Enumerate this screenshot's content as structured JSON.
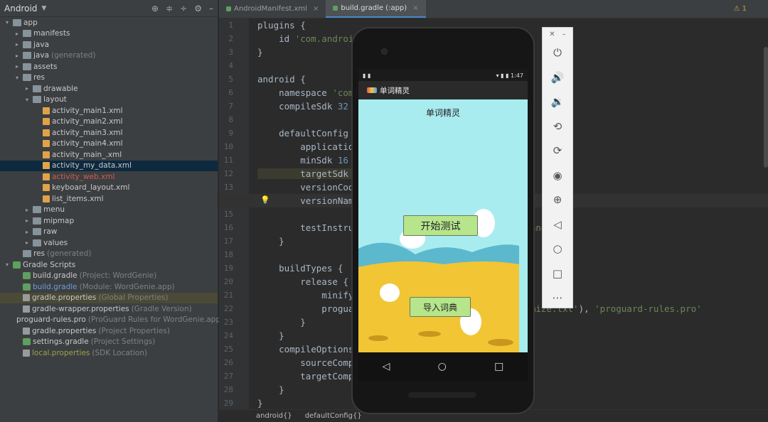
{
  "project_panel": {
    "title": "Android",
    "tree": [
      {
        "label": "app",
        "depth": 0,
        "arrow": "▾",
        "icon": "folder-icon",
        "style": ""
      },
      {
        "label": "manifests",
        "depth": 1,
        "arrow": "▸",
        "icon": "folder-icon",
        "style": ""
      },
      {
        "label": "java",
        "depth": 1,
        "arrow": "▸",
        "icon": "folder-icon",
        "style": ""
      },
      {
        "label": "java",
        "hint": "(generated)",
        "depth": 1,
        "arrow": "▸",
        "icon": "folder-icon",
        "style": ""
      },
      {
        "label": "assets",
        "depth": 1,
        "arrow": "▸",
        "icon": "folder-icon",
        "style": ""
      },
      {
        "label": "res",
        "depth": 1,
        "arrow": "▾",
        "icon": "folder-icon",
        "style": ""
      },
      {
        "label": "drawable",
        "depth": 2,
        "arrow": "▸",
        "icon": "folder-icon",
        "style": ""
      },
      {
        "label": "layout",
        "depth": 2,
        "arrow": "▾",
        "icon": "folder-icon",
        "style": ""
      },
      {
        "label": "activity_main1.xml",
        "depth": 3,
        "arrow": "",
        "icon": "xml-file-icon",
        "style": ""
      },
      {
        "label": "activity_main2.xml",
        "depth": 3,
        "arrow": "",
        "icon": "xml-file-icon",
        "style": ""
      },
      {
        "label": "activity_main3.xml",
        "depth": 3,
        "arrow": "",
        "icon": "xml-file-icon",
        "style": ""
      },
      {
        "label": "activity_main4.xml",
        "depth": 3,
        "arrow": "",
        "icon": "xml-file-icon",
        "style": ""
      },
      {
        "label": "activity_main_.xml",
        "depth": 3,
        "arrow": "",
        "icon": "xml-file-icon",
        "style": ""
      },
      {
        "label": "activity_my_data.xml",
        "depth": 3,
        "arrow": "",
        "icon": "xml-file-icon",
        "style": "selected"
      },
      {
        "label": "activity_web.xml",
        "depth": 3,
        "arrow": "",
        "icon": "xml-file-icon",
        "style": "red"
      },
      {
        "label": "keyboard_layout.xml",
        "depth": 3,
        "arrow": "",
        "icon": "xml-file-icon",
        "style": ""
      },
      {
        "label": "list_items.xml",
        "depth": 3,
        "arrow": "",
        "icon": "xml-file-icon",
        "style": ""
      },
      {
        "label": "menu",
        "depth": 2,
        "arrow": "▸",
        "icon": "folder-icon",
        "style": ""
      },
      {
        "label": "mipmap",
        "depth": 2,
        "arrow": "▸",
        "icon": "folder-icon",
        "style": ""
      },
      {
        "label": "raw",
        "depth": 2,
        "arrow": "▸",
        "icon": "folder-icon",
        "style": ""
      },
      {
        "label": "values",
        "depth": 2,
        "arrow": "▸",
        "icon": "folder-icon",
        "style": ""
      },
      {
        "label": "res",
        "hint": "(generated)",
        "depth": 1,
        "arrow": "",
        "icon": "folder-icon",
        "style": ""
      },
      {
        "label": "Gradle Scripts",
        "depth": 0,
        "arrow": "▾",
        "icon": "gradle-icon",
        "style": ""
      },
      {
        "label": "build.gradle",
        "hint": "(Project: WordGenie)",
        "depth": 1,
        "arrow": "",
        "icon": "gradle-icon",
        "style": ""
      },
      {
        "label": "build.gradle",
        "hint": "(Module: WordGenie.app)",
        "depth": 1,
        "arrow": "",
        "icon": "gradle-icon",
        "style": "blue"
      },
      {
        "label": "gradle.properties",
        "hint": "(Global Properties)",
        "depth": 1,
        "arrow": "",
        "icon": "properties-file-icon",
        "style": "highlight"
      },
      {
        "label": "gradle-wrapper.properties",
        "hint": "(Gradle Version)",
        "depth": 1,
        "arrow": "",
        "icon": "properties-file-icon",
        "style": ""
      },
      {
        "label": "proguard-rules.pro",
        "hint": "(ProGuard Rules for WordGenie.app)",
        "depth": 1,
        "arrow": "",
        "icon": "properties-file-icon",
        "style": ""
      },
      {
        "label": "gradle.properties",
        "hint": "(Project Properties)",
        "depth": 1,
        "arrow": "",
        "icon": "properties-file-icon",
        "style": ""
      },
      {
        "label": "settings.gradle",
        "hint": "(Project Settings)",
        "depth": 1,
        "arrow": "",
        "icon": "gradle-icon",
        "style": ""
      },
      {
        "label": "local.properties",
        "hint": "(SDK Location)",
        "depth": 1,
        "arrow": "",
        "icon": "properties-file-icon",
        "style": "olive"
      }
    ]
  },
  "editor": {
    "tabs": [
      {
        "label": "AndroidManifest.xml",
        "active": false
      },
      {
        "label": "build.gradle (:app)",
        "active": true
      }
    ],
    "warning_count": "1",
    "current_line": 14,
    "lines": [
      [
        {
          "t": "plugins {",
          "c": ""
        }
      ],
      [
        {
          "t": "    id ",
          "c": ""
        },
        {
          "t": "'com.android",
          "c": "str"
        }
      ],
      [
        {
          "t": "}",
          "c": ""
        }
      ],
      [],
      [
        {
          "t": "android {",
          "c": ""
        }
      ],
      [
        {
          "t": "    namespace ",
          "c": ""
        },
        {
          "t": "'com.",
          "c": "str"
        }
      ],
      [
        {
          "t": "    compileSdk ",
          "c": ""
        },
        {
          "t": "32",
          "c": "num"
        }
      ],
      [],
      [
        {
          "t": "    defaultConfig {",
          "c": ""
        }
      ],
      [
        {
          "t": "        applicatio",
          "c": ""
        }
      ],
      [
        {
          "t": "        minSdk ",
          "c": ""
        },
        {
          "t": "16",
          "c": "num"
        }
      ],
      [
        {
          "t": "        targetSdk ",
          "c": "hl"
        },
        {
          "t": "3",
          "c": "num"
        }
      ],
      [
        {
          "t": "        versionCode",
          "c": ""
        }
      ],
      [
        {
          "t": "        versionName",
          "c": ""
        }
      ],
      [],
      [
        {
          "t": "        testInstrum",
          "c": ""
        },
        {
          "t": "                               ",
          "c": ""
        },
        {
          "t": "unner\"",
          "c": "str"
        }
      ],
      [
        {
          "t": "    }",
          "c": ""
        }
      ],
      [],
      [
        {
          "t": "    buildTypes {",
          "c": ""
        }
      ],
      [
        {
          "t": "        release {",
          "c": ""
        }
      ],
      [
        {
          "t": "            minifyE",
          "c": ""
        }
      ],
      [
        {
          "t": "            proguar",
          "c": ""
        },
        {
          "t": "                          ",
          "c": ""
        },
        {
          "t": "d-optimize.txt'",
          "c": "str"
        },
        {
          "t": "), ",
          "c": ""
        },
        {
          "t": "'proguard-rules.pro'",
          "c": "str"
        }
      ],
      [
        {
          "t": "        }",
          "c": ""
        }
      ],
      [
        {
          "t": "    }",
          "c": ""
        }
      ],
      [
        {
          "t": "    compileOptions",
          "c": ""
        }
      ],
      [
        {
          "t": "        sourceCompa",
          "c": ""
        }
      ],
      [
        {
          "t": "        targetCompa",
          "c": ""
        }
      ],
      [
        {
          "t": "    }",
          "c": ""
        }
      ],
      [
        {
          "t": "}",
          "c": ""
        }
      ]
    ],
    "breadcrumb": [
      "android{}",
      "defaultConfig{}"
    ]
  },
  "emulator": {
    "status_time": "1:47",
    "app_title": "单词精灵",
    "screen_heading": "单词精灵",
    "start_button": "开始测试",
    "import_button": "导入词典",
    "nav": {
      "back": "◁",
      "home": "○",
      "recents": "□"
    }
  },
  "emulator_toolbar": {
    "tools": [
      "power-icon",
      "volume-up-icon",
      "volume-down-icon",
      "rotate-left-icon",
      "rotate-right-icon",
      "camera-icon",
      "zoom-icon",
      "back-icon",
      "home-icon",
      "overview-icon",
      "more-icon"
    ]
  },
  "colors": {
    "sky": "#a8ecf0",
    "sand": "#f2c534",
    "hill": "#5cb8cc",
    "button": "#b6e58c"
  }
}
